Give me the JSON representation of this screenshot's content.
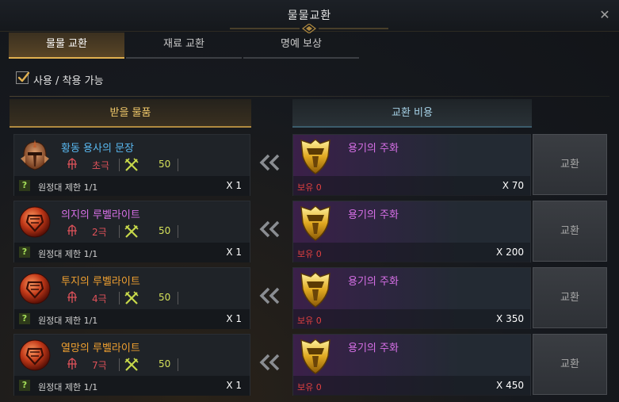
{
  "window": {
    "title": "물물교환"
  },
  "tabs": [
    {
      "label": "물물 교환",
      "active": true
    },
    {
      "label": "재료 교환",
      "active": false
    },
    {
      "label": "명예 보상",
      "active": false
    }
  ],
  "filter": {
    "label": "사용 / 착용 가능",
    "checked": true
  },
  "columns": {
    "receive": "받을 물품",
    "cost": "교환 비용"
  },
  "rows": [
    {
      "item_name": "황동 용사의 문장",
      "item_color": "#59b8f0",
      "item_icon": "bronze-helmet-icon",
      "grade": "초극",
      "level": "50",
      "limit": "원정대 제한 1/1",
      "receive_qty": "X 1",
      "cost_name": "용기의 주화",
      "owned": "보유 0",
      "cost_qty": "X 70",
      "button": "교환"
    },
    {
      "item_name": "의지의 루벨라이트",
      "item_color": "#d870e8",
      "item_icon": "rubellite-gem-icon",
      "grade": "2극",
      "level": "50",
      "limit": "원정대 제한 1/1",
      "receive_qty": "X 1",
      "cost_name": "용기의 주화",
      "owned": "보유 0",
      "cost_qty": "X 200",
      "button": "교환"
    },
    {
      "item_name": "투지의 루벨라이트",
      "item_color": "#f0a030",
      "item_icon": "rubellite-gem-icon",
      "grade": "4극",
      "level": "50",
      "limit": "원정대 제한 1/1",
      "receive_qty": "X 1",
      "cost_name": "용기의 주화",
      "owned": "보유 0",
      "cost_qty": "X 350",
      "button": "교환"
    },
    {
      "item_name": "열망의 루벨라이트",
      "item_color": "#f0a030",
      "item_icon": "rubellite-gem-icon",
      "grade": "7극",
      "level": "50",
      "limit": "원정대 제한 1/1",
      "receive_qty": "X 1",
      "cost_name": "용기의 주화",
      "owned": "보유 0",
      "cost_qty": "X 450",
      "button": "교환"
    }
  ]
}
